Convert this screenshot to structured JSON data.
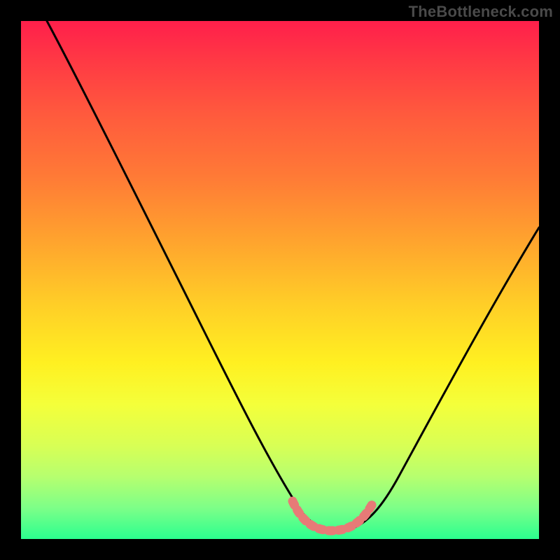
{
  "watermark": "TheBottleneck.com",
  "chart_data": {
    "type": "line",
    "title": "",
    "xlabel": "",
    "ylabel": "",
    "xlim": [
      0,
      100
    ],
    "ylim": [
      0,
      100
    ],
    "grid": false,
    "legend": false,
    "series": [
      {
        "name": "bottleneck-curve",
        "color": "#000000",
        "x": [
          5,
          10,
          15,
          20,
          25,
          30,
          35,
          40,
          45,
          50,
          52,
          55,
          58,
          60,
          63,
          65,
          68,
          72,
          78,
          85,
          92,
          100
        ],
        "y": [
          100,
          91,
          82,
          73,
          64,
          55,
          46,
          37,
          28,
          16,
          10,
          4,
          2,
          2,
          2,
          4,
          8,
          15,
          25,
          37,
          48,
          60
        ]
      },
      {
        "name": "range-marker",
        "color": "#e77a77",
        "x": [
          52,
          55,
          58,
          60,
          63,
          65,
          68
        ],
        "y": [
          8,
          3,
          2,
          2,
          2,
          3,
          8
        ]
      }
    ],
    "annotations": []
  }
}
